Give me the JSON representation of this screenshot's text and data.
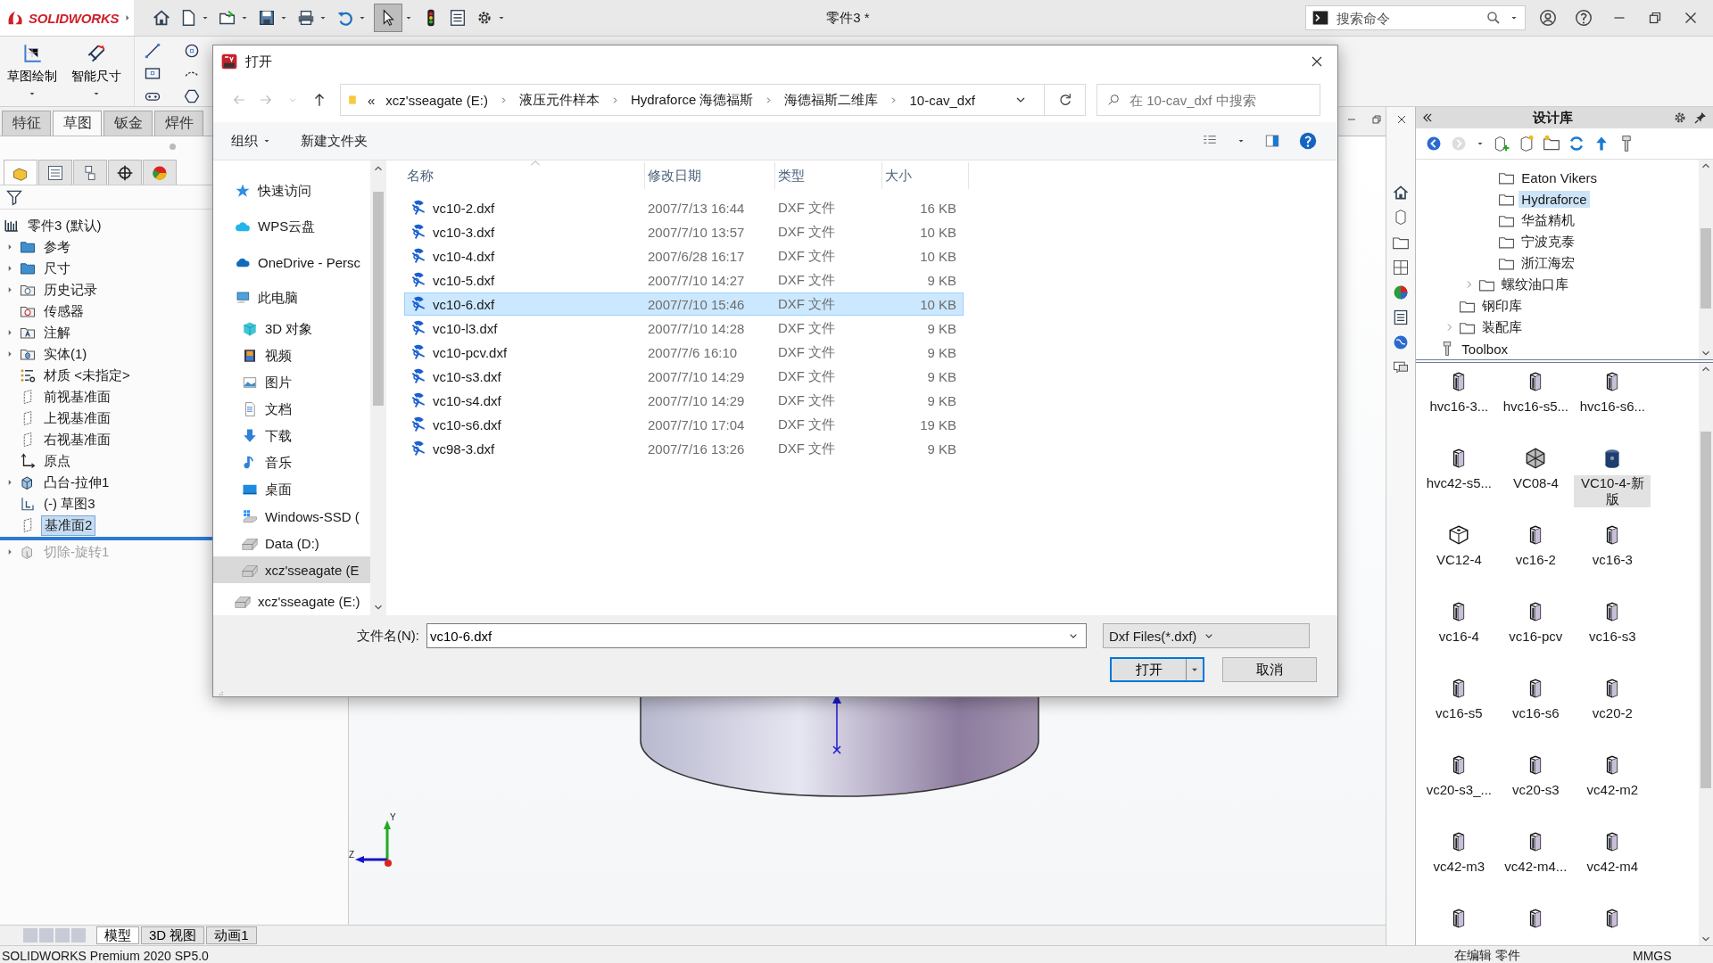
{
  "app": {
    "logo": "SOLIDWORKS",
    "document_title": "零件3 *",
    "search": {
      "placeholder": "搜索命令"
    }
  },
  "command_manager": {
    "buttons": [
      {
        "label": "草图绘制",
        "kind": "sketch"
      },
      {
        "label": "智能尺寸",
        "kind": "dimension"
      }
    ],
    "tabs": [
      {
        "label": "特征",
        "selected": false
      },
      {
        "label": "草图",
        "selected": true
      },
      {
        "label": "钣金",
        "selected": false
      },
      {
        "label": "焊件",
        "selected": false
      }
    ]
  },
  "feature_manager": {
    "tabs": [
      {
        "kind": "part",
        "selected": true
      },
      {
        "kind": "property",
        "selected": false
      },
      {
        "kind": "config",
        "selected": false
      },
      {
        "kind": "dimxpert",
        "selected": false
      },
      {
        "kind": "display",
        "selected": false
      }
    ],
    "tree": {
      "label": "零件3 (默认)",
      "kind": "part",
      "children": [
        {
          "label": "参考",
          "kind": "folder",
          "expanded": false,
          "selected": false,
          "disabled": false
        },
        {
          "label": "尺寸",
          "kind": "folder",
          "expanded": false,
          "selected": false,
          "disabled": false
        },
        {
          "label": "历史记录",
          "kind": "history",
          "expanded": false,
          "selected": false,
          "disabled": false
        },
        {
          "label": "传感器",
          "kind": "sensor",
          "selected": false,
          "disabled": false
        },
        {
          "label": "注解",
          "kind": "annotation",
          "expanded": false,
          "selected": false,
          "disabled": false
        },
        {
          "label": "实体(1)",
          "kind": "solid",
          "expanded": false,
          "selected": false,
          "disabled": false
        },
        {
          "label": "材质 <未指定>",
          "kind": "material",
          "selected": false,
          "disabled": false
        },
        {
          "label": "前视基准面",
          "kind": "plane",
          "selected": false,
          "disabled": false
        },
        {
          "label": "上视基准面",
          "kind": "plane",
          "selected": false,
          "disabled": false
        },
        {
          "label": "右视基准面",
          "kind": "plane",
          "selected": false,
          "disabled": false
        },
        {
          "label": "原点",
          "kind": "origin",
          "selected": false,
          "disabled": false
        },
        {
          "label": "凸台-拉伸1",
          "kind": "extrude",
          "expanded": false,
          "selected": false,
          "disabled": false
        },
        {
          "label": "(-) 草图3",
          "kind": "sketch",
          "selected": false,
          "disabled": false
        },
        {
          "label": "基准面2",
          "kind": "plane",
          "selected": true,
          "disabled": false
        },
        {
          "kind": "rollback_bar"
        },
        {
          "label": "切除-旋转1",
          "kind": "cut",
          "expanded": false,
          "selected": false,
          "disabled": true
        }
      ]
    }
  },
  "viewport": {
    "triad": {
      "y_label": "Y",
      "z_label": "Z"
    }
  },
  "bottom_tabs": [
    {
      "label": "模型",
      "selected": true
    },
    {
      "label": "3D 视图",
      "selected": false
    },
    {
      "label": "动画1",
      "selected": false
    }
  ],
  "design_library": {
    "title": "设计库",
    "tree": [
      {
        "children": [
          {
            "children": [
              {
                "children": [
                  {
                    "label": "Eaton Vikers",
                    "kind": "folder",
                    "selected": false
                  },
                  {
                    "label": "Hydraforce",
                    "kind": "folder",
                    "selected": true
                  },
                  {
                    "label": "华益精机",
                    "kind": "folder",
                    "selected": false
                  },
                  {
                    "label": "宁波克泰",
                    "kind": "folder",
                    "selected": false
                  },
                  {
                    "label": "浙江海宏",
                    "kind": "folder",
                    "selected": false
                  }
                ]
              },
              {
                "label": "螺纹油口库",
                "kind": "folder",
                "expanded": false,
                "selected": false
              }
            ]
          },
          {
            "label": "钢印库",
            "kind": "folder",
            "selected": false
          },
          {
            "label": "装配库",
            "kind": "folder",
            "expanded": false,
            "selected": false
          }
        ]
      },
      {
        "label": "Toolbox",
        "kind": "toolbox",
        "selected": false
      }
    ],
    "items": [
      {
        "label": "hvc16-3...",
        "kind": "block",
        "selected": false
      },
      {
        "label": "hvc16-s5...",
        "kind": "block",
        "selected": false
      },
      {
        "label": "hvc16-s6...",
        "kind": "block",
        "selected": false
      },
      {
        "label": "hvc42-s5...",
        "kind": "block",
        "selected": false
      },
      {
        "label": "VC08-4",
        "kind": "hex",
        "selected": false
      },
      {
        "label": "VC10-4-新版",
        "kind": "cylinder",
        "selected": true
      },
      {
        "label": "VC12-4",
        "kind": "cube",
        "selected": false
      },
      {
        "label": "vc16-2",
        "kind": "block",
        "selected": false
      },
      {
        "label": "vc16-3",
        "kind": "block",
        "selected": false
      },
      {
        "label": "vc16-4",
        "kind": "block",
        "selected": false
      },
      {
        "label": "vc16-pcv",
        "kind": "block",
        "selected": false
      },
      {
        "label": "vc16-s3",
        "kind": "block",
        "selected": false
      },
      {
        "label": "vc16-s5",
        "kind": "block",
        "selected": false
      },
      {
        "label": "vc16-s6",
        "kind": "block",
        "selected": false
      },
      {
        "label": "vc20-2",
        "kind": "block",
        "selected": false
      },
      {
        "label": "vc20-s3_...",
        "kind": "block",
        "selected": false
      },
      {
        "label": "vc20-s3",
        "kind": "block",
        "selected": false
      },
      {
        "label": "vc42-m2",
        "kind": "block",
        "selected": false
      },
      {
        "label": "vc42-m3",
        "kind": "block",
        "selected": false
      },
      {
        "label": "vc42-m4...",
        "kind": "block",
        "selected": false
      },
      {
        "label": "vc42-m4",
        "kind": "block",
        "selected": false
      },
      {
        "kind": "block"
      },
      {
        "kind": "block"
      },
      {
        "kind": "block"
      }
    ]
  },
  "open_dialog": {
    "title": "打开",
    "path_overflow": "«",
    "breadcrumbs": [
      "xcz'sseagate (E:)",
      "液压元件样本",
      "Hydraforce 海德福斯",
      "海德福斯二维库",
      "10-cav_dxf"
    ],
    "search": {
      "placeholder": "在 10-cav_dxf 中搜索"
    },
    "toolbar": [
      {
        "label": "组织",
        "kind": "menu"
      },
      {
        "label": "新建文件夹",
        "kind": "button"
      }
    ],
    "nav": [
      {
        "label": "快速访问",
        "kind": "quick",
        "selected": false
      },
      {
        "label": "WPS云盘",
        "kind": "wps",
        "selected": false
      },
      {
        "label": "OneDrive - Persc",
        "kind": "onedrive",
        "selected": false
      },
      {
        "label": "此电脑",
        "kind": "pc",
        "selected": false,
        "children": [
          {
            "label": "3D 对象",
            "kind": "objects",
            "selected": false
          },
          {
            "label": "视频",
            "kind": "video",
            "selected": false
          },
          {
            "label": "图片",
            "kind": "pictures",
            "selected": false
          },
          {
            "label": "文档",
            "kind": "documents",
            "selected": false
          },
          {
            "label": "下载",
            "kind": "downloads",
            "selected": false
          },
          {
            "label": "音乐",
            "kind": "music",
            "selected": false
          },
          {
            "label": "桌面",
            "kind": "desktop",
            "selected": false
          },
          {
            "label": "Windows-SSD (",
            "kind": "windows_drive",
            "selected": false
          },
          {
            "label": "Data (D:)",
            "kind": "drive",
            "selected": false
          },
          {
            "label": "xcz'sseagate (E",
            "kind": "drive",
            "selected": true
          }
        ]
      },
      {
        "label": "xcz'sseagate (E:)",
        "kind": "drive",
        "selected": false
      }
    ],
    "columns": [
      "名称",
      "修改日期",
      "类型",
      "大小"
    ],
    "files": [
      {
        "name": "vc10-2.dxf",
        "date": "2007/7/13 16:44",
        "type": "DXF 文件",
        "size": "16 KB",
        "selected": false
      },
      {
        "name": "vc10-3.dxf",
        "date": "2007/7/10 13:57",
        "type": "DXF 文件",
        "size": "10 KB",
        "selected": false
      },
      {
        "name": "vc10-4.dxf",
        "date": "2007/6/28 16:17",
        "type": "DXF 文件",
        "size": "10 KB",
        "selected": false
      },
      {
        "name": "vc10-5.dxf",
        "date": "2007/7/10 14:27",
        "type": "DXF 文件",
        "size": "9 KB",
        "selected": false
      },
      {
        "name": "vc10-6.dxf",
        "date": "2007/7/10 15:46",
        "type": "DXF 文件",
        "size": "10 KB",
        "selected": true
      },
      {
        "name": "vc10-l3.dxf",
        "date": "2007/7/10 14:28",
        "type": "DXF 文件",
        "size": "9 KB",
        "selected": false
      },
      {
        "name": "vc10-pcv.dxf",
        "date": "2007/7/6 16:10",
        "type": "DXF 文件",
        "size": "9 KB",
        "selected": false
      },
      {
        "name": "vc10-s3.dxf",
        "date": "2007/7/10 14:29",
        "type": "DXF 文件",
        "size": "9 KB",
        "selected": false
      },
      {
        "name": "vc10-s4.dxf",
        "date": "2007/7/10 14:29",
        "type": "DXF 文件",
        "size": "9 KB",
        "selected": false
      },
      {
        "name": "vc10-s6.dxf",
        "date": "2007/7/10 17:04",
        "type": "DXF 文件",
        "size": "19 KB",
        "selected": false
      },
      {
        "name": "vc98-3.dxf",
        "date": "2007/7/16 13:26",
        "type": "DXF 文件",
        "size": "9 KB",
        "selected": false
      }
    ],
    "file_name_label": "文件名(N):",
    "file_name": "vc10-6.dxf",
    "file_type": "Dxf Files(*.dxf)",
    "buttons": [
      {
        "label": "打开",
        "kind": "primary"
      },
      {
        "label": "取消",
        "kind": "secondary"
      }
    ]
  },
  "status_bar": {
    "product": "SOLIDWORKS Premium 2020 SP5.0",
    "mode": "在编辑 零件",
    "units": "MMGS"
  }
}
